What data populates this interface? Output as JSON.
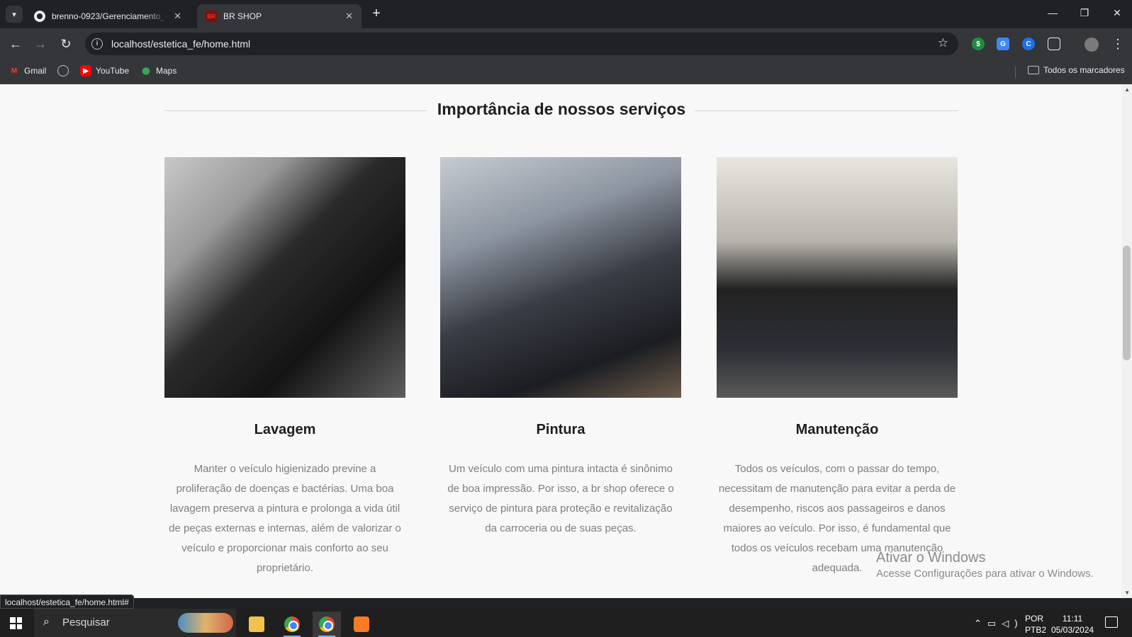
{
  "browser": {
    "tabs": [
      {
        "title": "brenno-0923/Gerenciamento_e"
      },
      {
        "title": "BR SHOP"
      }
    ],
    "url": "localhost/estetica_fe/home.html",
    "bookmarks": [
      "Gmail",
      "YouTube",
      "Maps"
    ],
    "all_bookmarks_label": "Todos os marcadores",
    "status_url": "localhost/estetica_fe/home.html#"
  },
  "page": {
    "section_title": "Importância de nossos serviços",
    "services": [
      {
        "title": "Lavagem",
        "text": "Manter o veículo higienizado previne a proliferação de doenças e bactérias. Uma boa lavagem preserva a pintura e prolonga a vida útil de peças externas e internas, além de valorizar o veículo e proporcionar mais conforto ao seu proprietário."
      },
      {
        "title": "Pintura",
        "text": "Um veículo com uma pintura intacta é sinônimo de boa impressão. Por isso, a br shop oferece o serviço de pintura para proteção e revitalização da carroceria ou de suas peças."
      },
      {
        "title": "Manutenção",
        "text": "Todos os veículos, com o passar do tempo, necessitam de manutenção para evitar a perda de desempenho, riscos aos passageiros e danos maiores ao veículo. Por isso, é fundamental que todos os veículos recebam uma manutenção adequada."
      }
    ]
  },
  "watermark": {
    "line1": "Ativar o Windows",
    "line2": "Acesse Configurações para ativar o Windows."
  },
  "taskbar": {
    "search_placeholder": "Pesquisar",
    "lang1": "POR",
    "lang2": "PTB2",
    "time": "11:11",
    "date": "05/03/2024"
  }
}
